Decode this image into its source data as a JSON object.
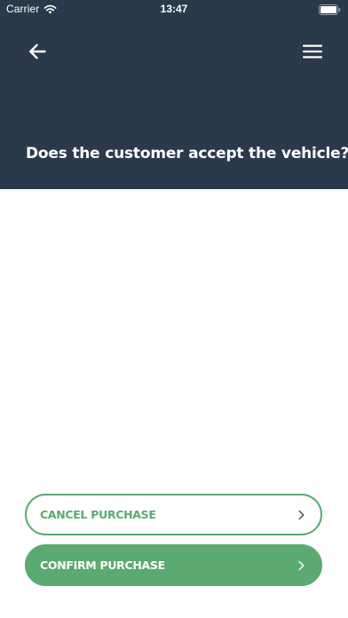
{
  "status_bar": {
    "carrier": "Carrier",
    "time": "13:47",
    "wifi_icon": "wifi-icon",
    "battery_icon": "battery-icon"
  },
  "nav": {
    "back_icon": "arrow-left-icon",
    "menu_icon": "hamburger-menu-icon"
  },
  "page": {
    "title": "Does the customer accept the vehicle?"
  },
  "actions": {
    "cancel_label": "CANCEL PURCHASE",
    "confirm_label": "CONFIRM PURCHASE",
    "chevron_icon": "chevron-right-icon"
  },
  "colors": {
    "header_bg": "#2a3a4a",
    "accent_green": "#5aaa72",
    "text_on_dark": "#ffffff",
    "background": "#ffffff"
  }
}
